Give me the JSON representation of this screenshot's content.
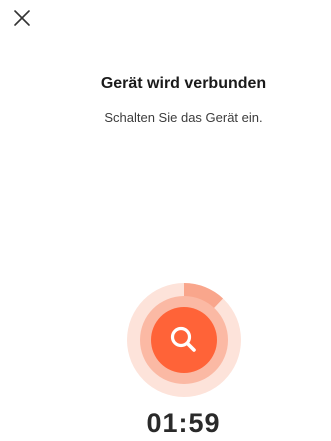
{
  "dialog": {
    "title": "Gerät wird verbunden",
    "subtitle": "Schalten Sie das Gerät ein.",
    "timer": "01:59"
  },
  "scanner": {
    "icon": "search-icon",
    "progress": 0.12
  },
  "colors": {
    "accent": "#ff6338",
    "ring_outer": "#fde3da",
    "ring_mid": "#fbb9a4",
    "ring_progress": "#f9a68c"
  }
}
